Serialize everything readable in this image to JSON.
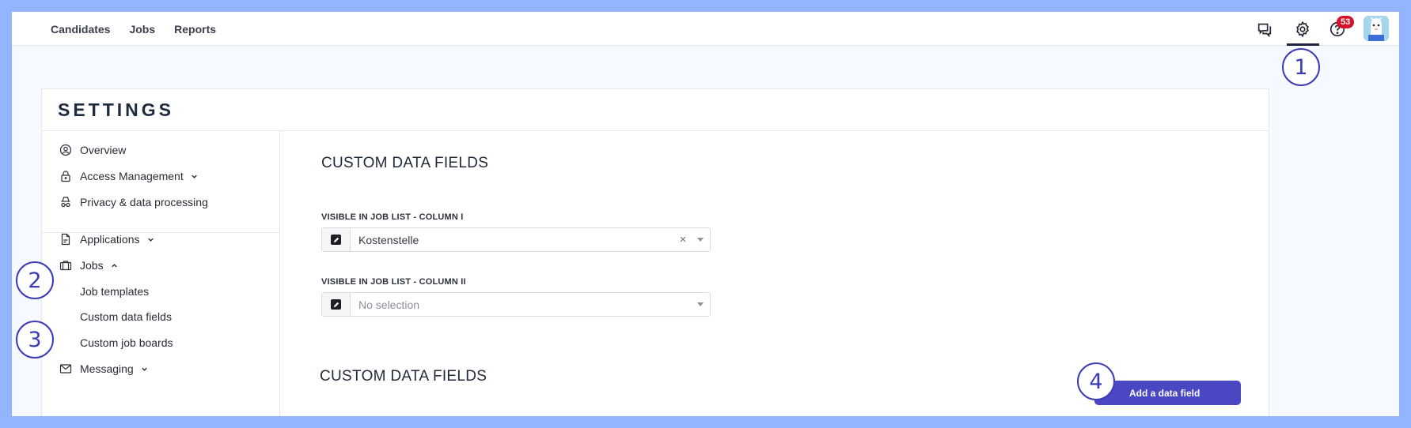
{
  "nav": {
    "items": [
      {
        "label": "Candidates"
      },
      {
        "label": "Jobs"
      },
      {
        "label": "Reports"
      }
    ]
  },
  "topbar": {
    "notification_count": "53",
    "icons": [
      "chat-icon",
      "gear-icon",
      "help-icon",
      "avatar"
    ]
  },
  "callouts": [
    "1",
    "2",
    "3",
    "4"
  ],
  "settings": {
    "title": "SETTINGS"
  },
  "sidebar": {
    "items": [
      {
        "label": "Overview",
        "icon": "user-circle-icon"
      },
      {
        "label": "Access Management",
        "icon": "lock-icon",
        "expandable": true
      },
      {
        "label": "Privacy & data processing",
        "icon": "incognito-icon"
      },
      {
        "label": "Applications",
        "icon": "document-icon",
        "expandable": true
      },
      {
        "label": "Jobs",
        "icon": "briefcase-icon",
        "expanded": true
      },
      {
        "label": "Messaging",
        "icon": "envelope-icon",
        "expandable": true
      }
    ],
    "jobs_sub": [
      {
        "label": "Job templates"
      },
      {
        "label": "Custom data fields"
      },
      {
        "label": "Custom job boards"
      }
    ]
  },
  "main": {
    "section1_title": "CUSTOM DATA FIELDS",
    "column1": {
      "label": "VISIBLE IN JOB LIST - COLUMN I",
      "value": "Kostenstelle"
    },
    "column2": {
      "label": "VISIBLE IN JOB LIST - COLUMN II",
      "placeholder": "No selection"
    },
    "section2_title": "CUSTOM DATA FIELDS",
    "add_button": "Add a data field"
  },
  "colors": {
    "accent": "#4a47c2",
    "callout": "#3b3bb3",
    "badge": "#d8112a",
    "backdrop": "#93b5ff"
  }
}
